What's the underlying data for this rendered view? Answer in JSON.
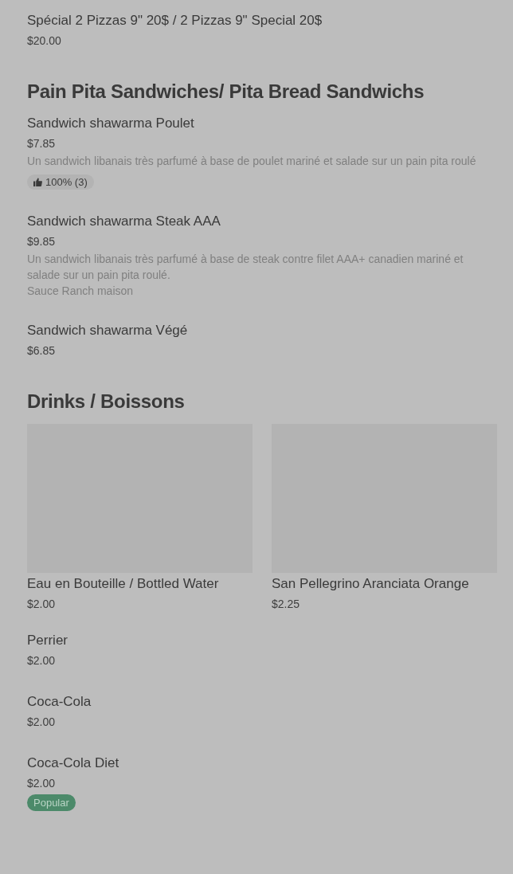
{
  "sections": [
    {
      "items": [
        {
          "name": "Spécial 2 Pizzas 9\" 20$ / 2 Pizzas 9\" Special 20$",
          "price": "$20.00"
        }
      ]
    },
    {
      "title": "Pain Pita Sandwiches/ Pita Bread Sandwichs",
      "items": [
        {
          "name": "Sandwich shawarma Poulet",
          "price": "$7.85",
          "description": [
            "Un sandwich libanais très parfumé à base de poulet mariné et salade sur un pain pita roulé"
          ],
          "rating": "100% (3)"
        },
        {
          "name": "Sandwich shawarma Steak AAA",
          "price": "$9.85",
          "description": [
            "Un sandwich libanais très parfumé à base de steak contre filet AAA+ canadien mariné et salade sur un pain pita roulé.",
            "Sauce Ranch maison"
          ]
        },
        {
          "name": "Sandwich shawarma Végé",
          "price": "$6.85"
        }
      ]
    },
    {
      "title": "Drinks / Boissons",
      "cards": [
        {
          "name": " Eau en Bouteille / Bottled Water",
          "price": "$2.00"
        },
        {
          "name": "San Pellegrino Aranciata Orange",
          "price": "$2.25"
        }
      ],
      "items": [
        {
          "name": "Perrier",
          "price": "$2.00"
        },
        {
          "name": "Coca-Cola",
          "price": "$2.00"
        },
        {
          "name": "Coca-Cola Diet",
          "price": "$2.00",
          "badge": "Popular"
        }
      ]
    }
  ]
}
